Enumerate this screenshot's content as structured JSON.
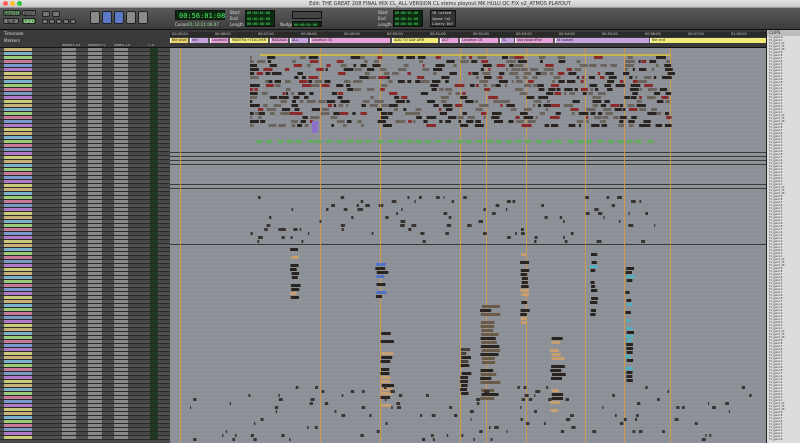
{
  "window": {
    "title": "Edit: THE GREAT 208 FINAL MIX CL_ALL VERSION CL stems playout MK HULU QC FIX v2_ATMOS PLAYOUT"
  },
  "toolbar": {
    "counter": "00:56:01:08",
    "counter_suffix": "▾",
    "cursor_label": "Cursor",
    "cursor_value": "01:10:21:06.07",
    "start_label": "Start",
    "end_label": "End",
    "length_label": "Length",
    "start_value": "00:56:01:08",
    "end_value": "00:56:01:08",
    "length_value": "00:00:00:00",
    "nudge_label": "Nudge",
    "nudge_value": "00:00:01:00",
    "end2_label": "End",
    "start2_label": "Start",
    "length2_label": "Length",
    "preroll_value": "00:00:01:00",
    "postroll_value": "00:00:01:00",
    "pre_length_value": "00:00:00:00",
    "grid_label": "Grid",
    "grid_value": "Speed Cal",
    "mode1": "SHUFFLE",
    "mode2": "SPOT",
    "mode3": "SLIP",
    "mode4": "GRID",
    "zoom_label": "Zoom",
    "status_lines": [
      "CB Locked",
      "Speed Cal",
      "Libary Buf"
    ]
  },
  "ruler": {
    "timecode_label": "Timecode",
    "markers_label": "Markers",
    "markers": [
      {
        "label": "file start",
        "color": "#e8d36b"
      },
      {
        "label": "Intr",
        "color": "#c7a2e0"
      },
      {
        "label": "Location 3",
        "color": "#e6a1d8"
      },
      {
        "label": "MARTHA+TEACHER",
        "color": "#f0ea7a"
      },
      {
        "label": "BAGAAA",
        "color": "#e6a1d8"
      },
      {
        "label": "ALL",
        "color": "#c7a2e0"
      },
      {
        "label": "Location 34",
        "color": "#e6a1d8"
      },
      {
        "label": "ADD TO DAY ARR",
        "color": "#f0ea7a"
      },
      {
        "label": "ACT",
        "color": "#e6a1d8"
      },
      {
        "label": "Location 18",
        "color": "#e6a1d8"
      },
      {
        "label": "TC",
        "color": "#c7a2e0"
      },
      {
        "label": "storyboardFile",
        "color": "#e6a1d8"
      },
      {
        "label": "Id noised",
        "color": "#c7a2e0"
      },
      {
        "label": "file end",
        "color": "#f0ea7a"
      }
    ],
    "timecodes": [
      "00:45:00",
      "00:46:00",
      "00:47:00",
      "00:48:00",
      "00:49:00",
      "00:50:00",
      "00:51:00",
      "00:52:00",
      "00:53:00",
      "00:54:00",
      "00:55:00",
      "00:56:00",
      "00:57:00",
      "01:00:00"
    ]
  },
  "tracklist": {
    "header_inserts_a": "INSERTS A-E",
    "header_inserts_f": "INSERTS F-J",
    "header_sends": "SENDS A-E",
    "header_io": "I / O"
  },
  "clips": {
    "header": "CLIPS",
    "items": [
      "Tx_gen5.0",
      "Tx_gen4.1",
      "Tx_gen3_14",
      "Tx_gen3_15",
      "Tx_gen3_16",
      "Tx_gen2.9",
      "Tx_gen2.8",
      "Tx_gen2.7",
      "Tx_gen2.6",
      "Tx_gen2.5",
      "Tx_gen2.4",
      "Tx_gen2.3",
      "Tx_gen2.2",
      "Tx_gen2.1",
      "Tx_gen1.9",
      "Tx_gen1.8",
      "Tx_gen1.7",
      "Tx_gen1.6",
      "Tx_gen1.5",
      "Tx_gen1.4",
      "Tx_gen1.3",
      "Tx_gen1.2",
      "Tx_gen1.1",
      "Tx_gen0.9"
    ]
  },
  "colors": {
    "edit_bg": "#8e9399",
    "counter_green": "#52f06a",
    "clip_dark": "#2a2420",
    "clip_green": "#5fae5a",
    "clip_tan": "#c8a070",
    "clip_blue": "#4f72c8",
    "clip_cyan": "#4fb0c0",
    "clip_purple": "#8a70c8",
    "guide_orange": "#e39a3a"
  }
}
